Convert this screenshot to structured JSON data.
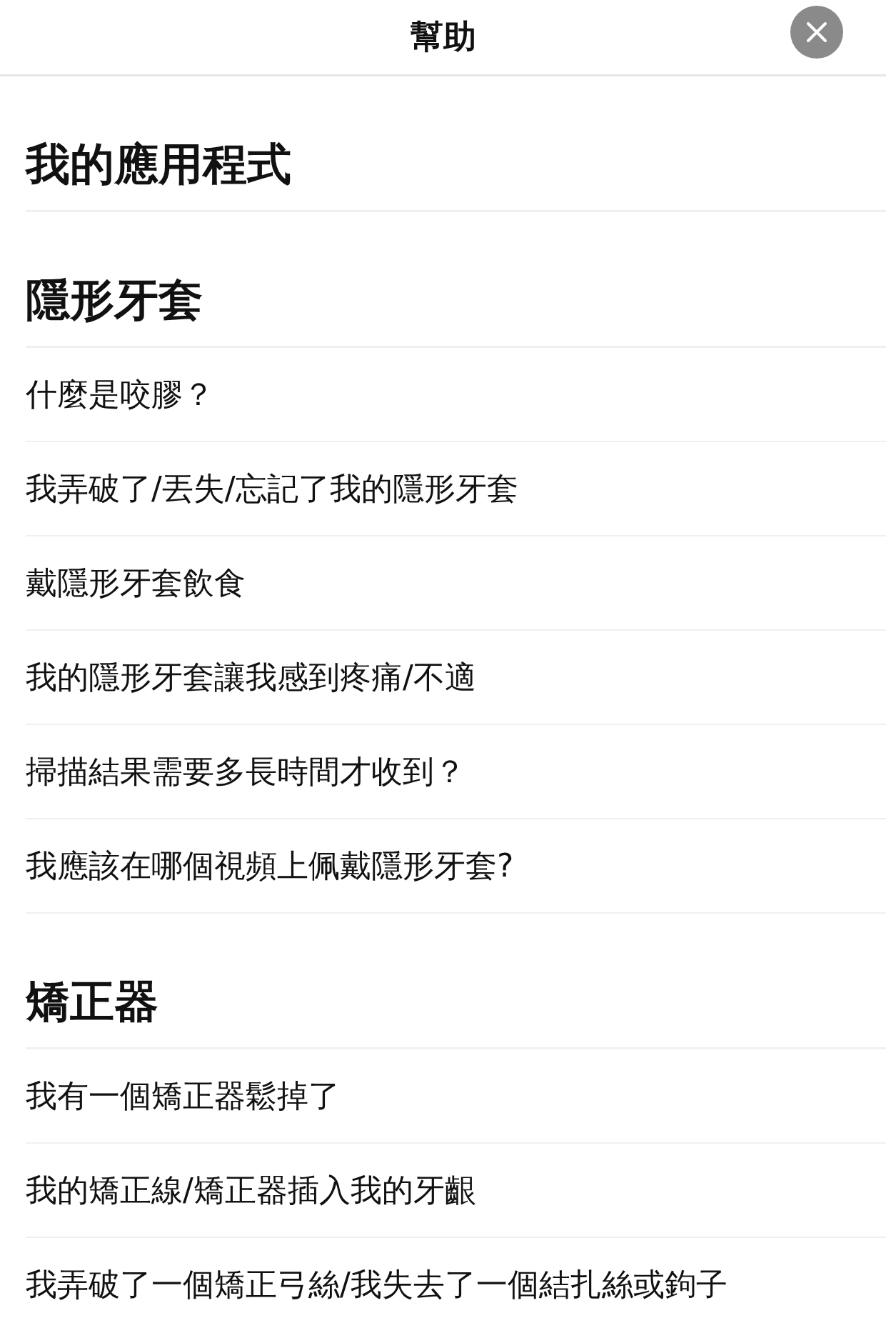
{
  "header": {
    "title": "幫助"
  },
  "sections": [
    {
      "title": "我的應用程式"
    },
    {
      "title": "隱形牙套",
      "items": [
        "什麼是咬膠？",
        "我弄破了/丟失/忘記了我的隱形牙套",
        "戴隱形牙套飲食",
        "我的隱形牙套讓我感到疼痛/不適",
        "掃描結果需要多長時間才收到？",
        "我應該在哪個視頻上佩戴隱形牙套?"
      ]
    },
    {
      "title": "矯正器",
      "items": [
        "我有一個矯正器鬆掉了",
        "我的矯正線/矯正器插入我的牙齦",
        "我弄破了一個矯正弓絲/我失去了一個結扎絲或鉤子"
      ]
    }
  ]
}
